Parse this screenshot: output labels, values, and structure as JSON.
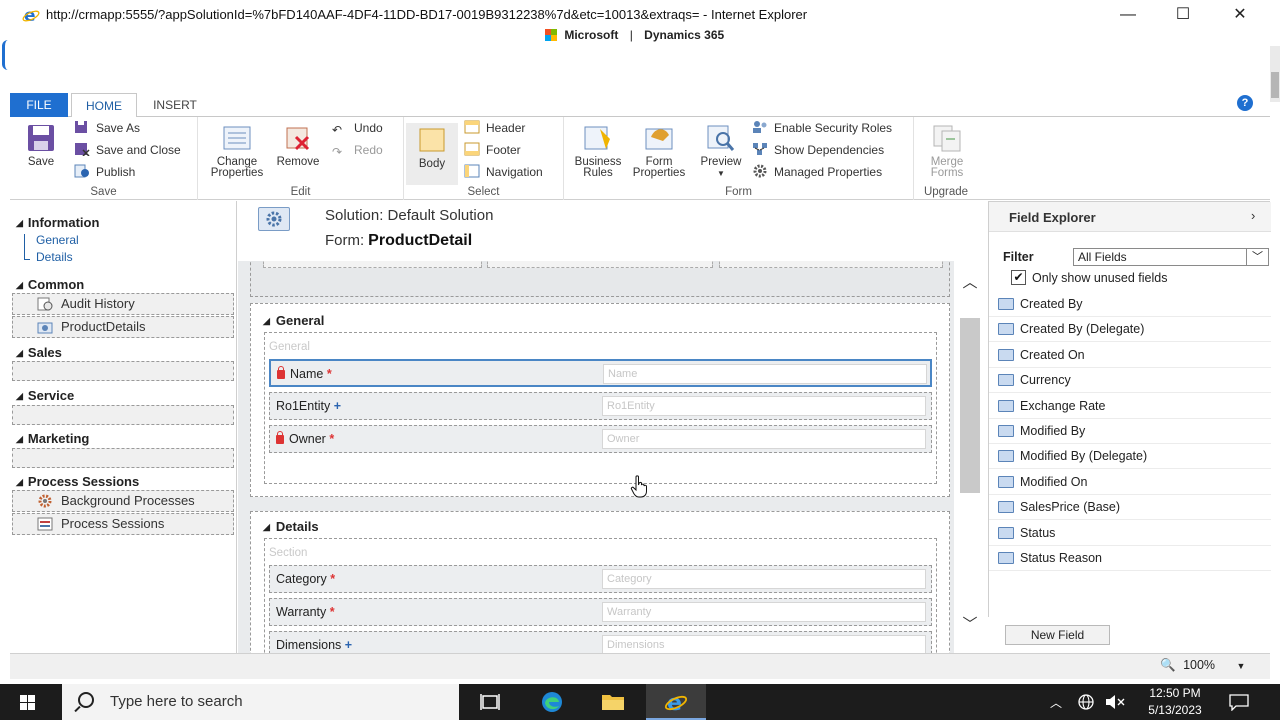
{
  "browser": {
    "title": "http://crmapp:5555/?appSolutionId=%7bFD140AAF-4DF4-11DD-BD17-0019B9312238%7d&etc=10013&extraqs= - Internet Explorer",
    "brand_microsoft": "Microsoft",
    "brand_separator": "|",
    "brand_product": "Dynamics 365",
    "minimize": "—",
    "maximize": "☐",
    "close": "✕"
  },
  "ribbon": {
    "tabs": {
      "file": "FILE",
      "home": "HOME",
      "insert": "INSERT"
    },
    "help": "?",
    "groups": {
      "save": {
        "label": "Save",
        "save": "Save",
        "save_as": "Save As",
        "save_and_close": "Save and Close",
        "publish": "Publish"
      },
      "edit": {
        "label": "Edit",
        "change_properties_1": "Change",
        "change_properties_2": "Properties",
        "remove": "Remove",
        "undo": "Undo",
        "redo": "Redo"
      },
      "select": {
        "label": "Select",
        "body": "Body",
        "header": "Header",
        "footer": "Footer",
        "navigation": "Navigation"
      },
      "form": {
        "label": "Form",
        "business_rules_1": "Business",
        "business_rules_2": "Rules",
        "form_properties_1": "Form",
        "form_properties_2": "Properties",
        "preview": "Preview",
        "enable_security_roles": "Enable Security Roles",
        "show_dependencies": "Show Dependencies",
        "managed_properties": "Managed Properties"
      },
      "upgrade": {
        "label": "Upgrade",
        "merge_forms_1": "Merge",
        "merge_forms_2": "Forms"
      }
    }
  },
  "leftnav": {
    "information": "Information",
    "general": "General",
    "details": "Details",
    "common": "Common",
    "audit_history": "Audit History",
    "product_details": "ProductDetails",
    "sales": "Sales",
    "service": "Service",
    "marketing": "Marketing",
    "process_sessions": "Process Sessions",
    "background_processes": "Background Processes",
    "process_sessions_item": "Process Sessions"
  },
  "form": {
    "solution": "Solution: Default Solution",
    "form_prefix": "Form:",
    "form_name": "ProductDetail",
    "tabs": [
      {
        "title": "General",
        "section_title": "General",
        "fields": [
          {
            "label": "Name",
            "marker": "*",
            "placeholder": "Name"
          },
          {
            "label": "Ro1Entity",
            "marker": "+",
            "placeholder": "Ro1Entity"
          },
          {
            "label": "Owner",
            "marker": "*",
            "placeholder": "Owner"
          }
        ]
      },
      {
        "title": "Details",
        "section_title": "Section",
        "fields": [
          {
            "label": "Category",
            "marker": "*",
            "placeholder": "Category"
          },
          {
            "label": "Warranty",
            "marker": "*",
            "placeholder": "Warranty"
          },
          {
            "label": "Dimensions",
            "marker": "+",
            "placeholder": "Dimensions"
          }
        ]
      }
    ]
  },
  "explorer": {
    "title": "Field Explorer",
    "arrow": "›",
    "filter_label": "Filter",
    "filter_value": "All Fields",
    "only_unused": "Only show unused fields",
    "only_unused_checked": true,
    "check_mark": "✔",
    "items": [
      "Created By",
      "Created By (Delegate)",
      "Created On",
      "Currency",
      "Exchange Rate",
      "Modified By",
      "Modified By (Delegate)",
      "Modified On",
      "SalesPrice (Base)",
      "Status",
      "Status Reason"
    ],
    "new_field": "New Field"
  },
  "statusbar": {
    "zoom": "100%"
  },
  "taskbar": {
    "search_placeholder": "Type here to search",
    "time": "12:50 PM",
    "date": "5/13/2023"
  },
  "colors": {
    "accent": "#1f6fd0",
    "required": "#dd3333",
    "recommended": "#2a64b0"
  }
}
